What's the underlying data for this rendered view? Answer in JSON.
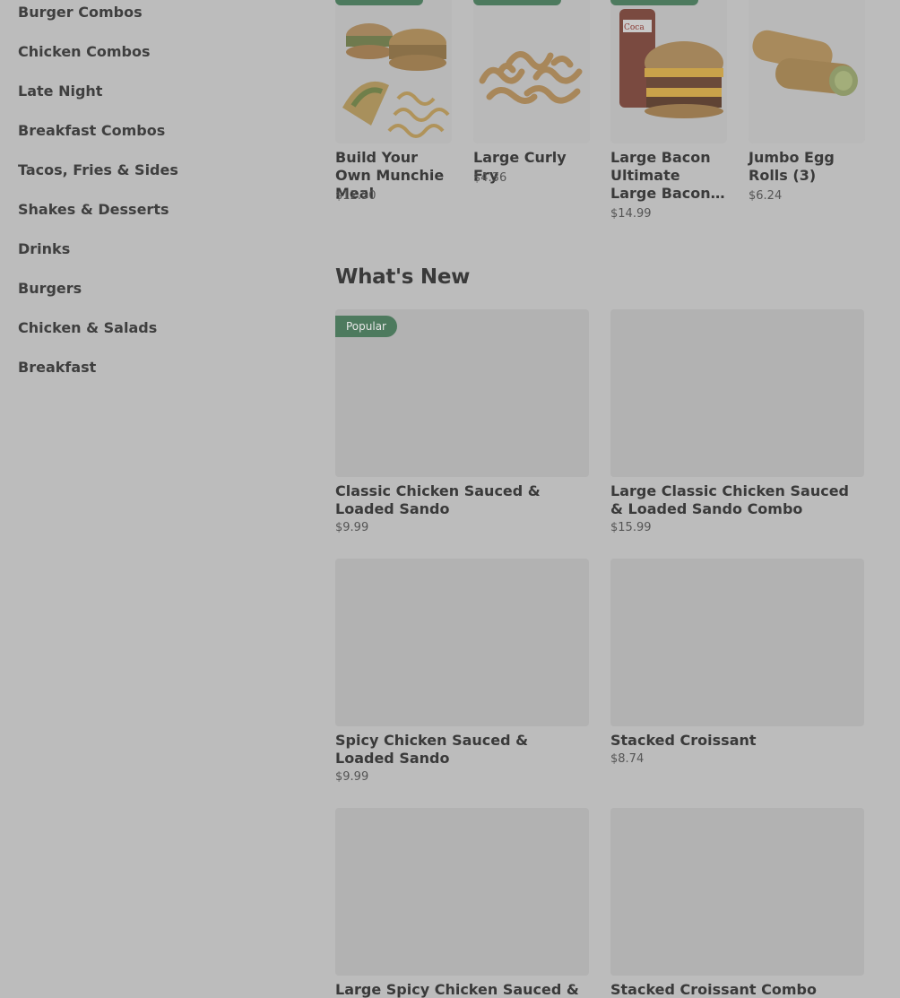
{
  "sidebar": {
    "items": [
      {
        "label": "Burger Combos"
      },
      {
        "label": "Chicken Combos"
      },
      {
        "label": "Late Night"
      },
      {
        "label": "Breakfast Combos"
      },
      {
        "label": "Tacos, Fries & Sides"
      },
      {
        "label": "Shakes & Desserts"
      },
      {
        "label": "Drinks"
      },
      {
        "label": "Burgers"
      },
      {
        "label": "Chicken & Salads"
      },
      {
        "label": "Breakfast"
      }
    ]
  },
  "carousel": {
    "items": [
      {
        "title": "Build Your Own Munchie Meal",
        "price": "$12.50",
        "image": "munchie-meal-image"
      },
      {
        "title": "Large Curly Fry",
        "price": "$4.36",
        "image": "curly-fry-image"
      },
      {
        "title": "Large Bacon Ultimate Cheeseburger™...",
        "price": "$14.99",
        "image": "bacon-cheeseburger-image"
      },
      {
        "title": "Jumbo Egg Rolls (3)",
        "price": "$6.24",
        "image": "egg-rolls-image"
      }
    ]
  },
  "whats_new": {
    "title": "What's New",
    "badge": "Popular",
    "items": [
      {
        "title": "Classic Chicken Sauced & Loaded Sando",
        "price": "$9.99"
      },
      {
        "title": "Large Classic Chicken Sauced & Loaded Sando Combo",
        "price": "$15.99"
      },
      {
        "title": "Spicy Chicken Sauced & Loaded Sando",
        "price": "$9.99"
      },
      {
        "title": "Stacked Croissant",
        "price": "$8.74"
      },
      {
        "title": "Large Spicy Chicken Sauced &",
        "price": ""
      },
      {
        "title": "Stacked Croissant Combo",
        "price": ""
      }
    ]
  },
  "colors": {
    "overlay_bg": "#bcbcbc",
    "accent_green": "#4d7a5e"
  }
}
